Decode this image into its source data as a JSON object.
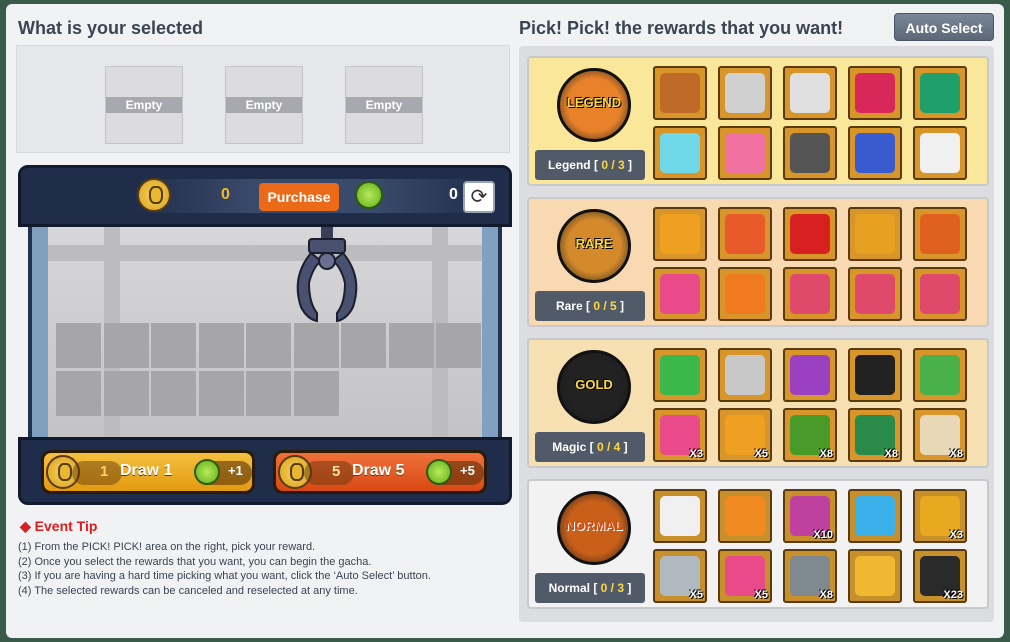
{
  "header": {
    "left_title": "What is your selected",
    "right_title": "Pick! Pick! the rewards that you want!",
    "auto_select": "Auto Select"
  },
  "selected_slots": [
    "Empty",
    "Empty",
    "Empty"
  ],
  "machine": {
    "coin_count": "0",
    "purchase_label": "Purchase",
    "gem_count": "0",
    "refresh_icon": "refresh-icon",
    "draw1": {
      "cost": "1",
      "label": "Draw 1",
      "bonus": "+1"
    },
    "draw5": {
      "cost": "5",
      "label": "Draw 5",
      "bonus": "+5"
    }
  },
  "event_tip": {
    "title": "◆ Event Tip",
    "lines": [
      "(1) From the PICK! PICK! area on the right, pick your reward.",
      "(2) Once you select the rewards that you want, you can begin the gacha.",
      "(3) If you are having a hard time picking what you want, click the ‘Auto Select’ button.",
      "(4) The selected rewards can be canceled and reselected at any time."
    ]
  },
  "rows": [
    {
      "name": "Legend",
      "ball_text": "LEGEND",
      "count": "0 / 3",
      "ball_color": "#e8822a"
    },
    {
      "name": "Rare",
      "ball_text": "RARE",
      "count": "0 / 5",
      "ball_color": "#d48a2a"
    },
    {
      "name": "Magic",
      "ball_text": "GOLD",
      "count": "0 / 4",
      "ball_color": "#222222"
    },
    {
      "name": "Normal",
      "ball_text": "NORMAL",
      "count": "0 / 3",
      "ball_color": "#c8601a"
    }
  ],
  "items": {
    "legend": [
      {
        "c": "#c06a2a"
      },
      {
        "c": "#d0d0d0"
      },
      {
        "c": "#e0e0e0"
      },
      {
        "c": "#d8285a"
      },
      {
        "c": "#1fa06a"
      },
      {
        "c": "#6ed8e8"
      },
      {
        "c": "#f070a0"
      },
      {
        "c": "#555"
      },
      {
        "c": "#3a5ad0"
      },
      {
        "c": "#f0f0f0"
      }
    ],
    "rare": [
      {
        "c": "#f0a020"
      },
      {
        "c": "#e85a2a"
      },
      {
        "c": "#d82020"
      },
      {
        "c": "#e8a020"
      },
      {
        "c": "#e06020"
      },
      {
        "c": "#e84a8a"
      },
      {
        "c": "#f07a20"
      },
      {
        "c": "#e04a6a"
      },
      {
        "c": "#e04a6a"
      },
      {
        "c": "#e04a6a"
      }
    ],
    "magic": [
      {
        "c": "#3ab84a",
        "q": ""
      },
      {
        "c": "#c8c8c8",
        "q": ""
      },
      {
        "c": "#9a40c0",
        "q": ""
      },
      {
        "c": "#222",
        "q": ""
      },
      {
        "c": "#4ab04a",
        "q": ""
      },
      {
        "c": "#e84a8a",
        "q": "X3"
      },
      {
        "c": "#f0a020",
        "q": "X5"
      },
      {
        "c": "#4a9a2a",
        "q": "X8"
      },
      {
        "c": "#2a8a4a",
        "q": "X8"
      },
      {
        "c": "#e8d8b8",
        "q": "X8"
      }
    ],
    "normal": [
      {
        "c": "#f0f0f0",
        "q": ""
      },
      {
        "c": "#f08a20",
        "q": ""
      },
      {
        "c": "#c040a0",
        "q": "X10"
      },
      {
        "c": "#3ab0e8",
        "q": ""
      },
      {
        "c": "#e8a820",
        "q": "X3"
      },
      {
        "c": "#b0b8c0",
        "q": "X5"
      },
      {
        "c": "#e84a8a",
        "q": "X5"
      },
      {
        "c": "#808890",
        "q": "X8"
      },
      {
        "c": "#f0b830",
        "q": ""
      },
      {
        "c": "#2a2a2a",
        "q": "X23"
      }
    ]
  }
}
